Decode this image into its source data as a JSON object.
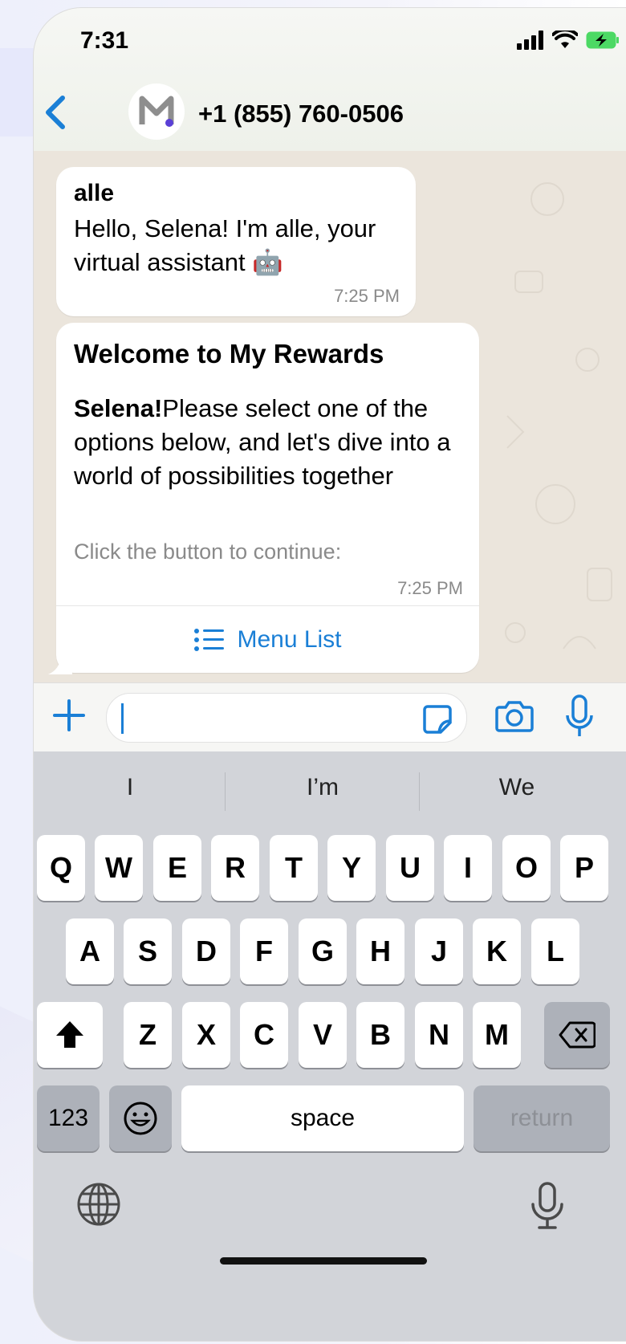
{
  "status": {
    "time": "7:31"
  },
  "header": {
    "contact": "+1 (855) 760-0506"
  },
  "messages": [
    {
      "sender": "alle",
      "text": "Hello, Selena! I'm alle, your virtual assistant 🤖",
      "time": "7:25 PM"
    },
    {
      "title": "Welcome to My Rewards",
      "bold_name": "Selena!",
      "body": "Please select one of the options below, and let's dive into a world of possibilities together",
      "footer": "Click the button to continue:",
      "time": "7:25 PM",
      "button_label": "Menu List"
    }
  ],
  "suggestions": [
    "I",
    "I’m",
    "We"
  ],
  "keyboard": {
    "row1": [
      "Q",
      "W",
      "E",
      "R",
      "T",
      "Y",
      "U",
      "I",
      "O",
      "P"
    ],
    "row2": [
      "A",
      "S",
      "D",
      "F",
      "G",
      "H",
      "J",
      "K",
      "L"
    ],
    "row3": [
      "Z",
      "X",
      "C",
      "V",
      "B",
      "N",
      "M"
    ],
    "numbers": "123",
    "space": "space",
    "return": "return"
  },
  "colors": {
    "accent": "#1a7fd6",
    "chat_bg": "#ebe5dc",
    "keyboard_bg": "#d2d4d9"
  }
}
